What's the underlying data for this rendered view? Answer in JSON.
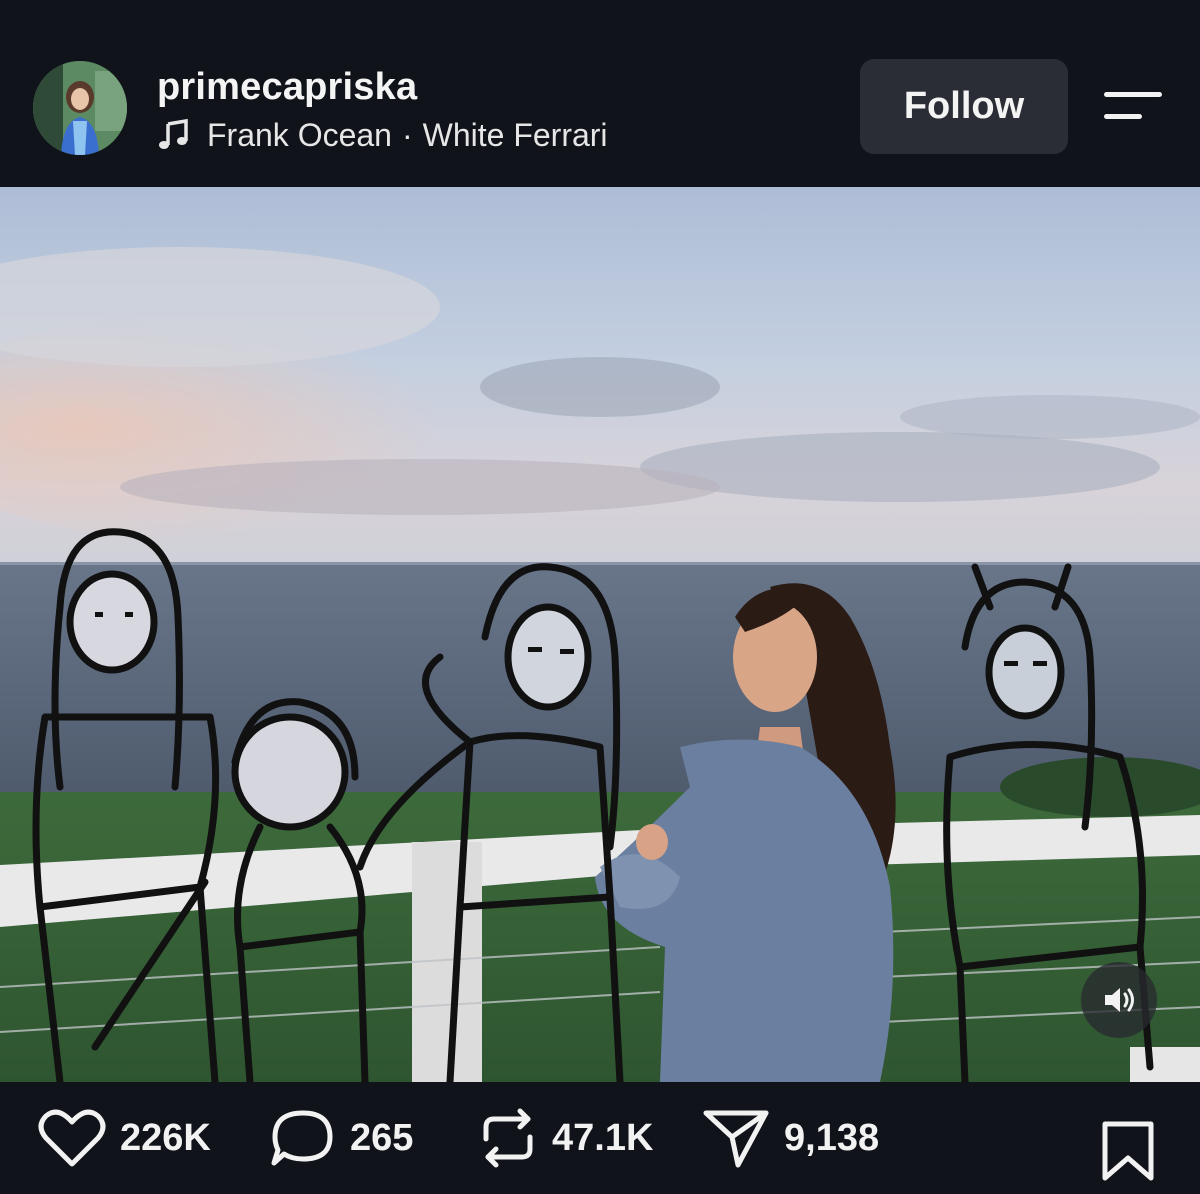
{
  "post": {
    "username": "primecapriska",
    "music": {
      "artist": "Frank Ocean",
      "separator": "·",
      "track": "White Ferrari"
    },
    "follow_label": "Follow",
    "menu_icon": "menu-icon",
    "volume_icon": "volume-icon"
  },
  "actions": {
    "likes": "226K",
    "comments": "265",
    "reposts": "47.1K",
    "shares": "9,138"
  },
  "colors": {
    "background": "#10131a",
    "button": "#2a2d35",
    "text": "#f2f2f2"
  }
}
